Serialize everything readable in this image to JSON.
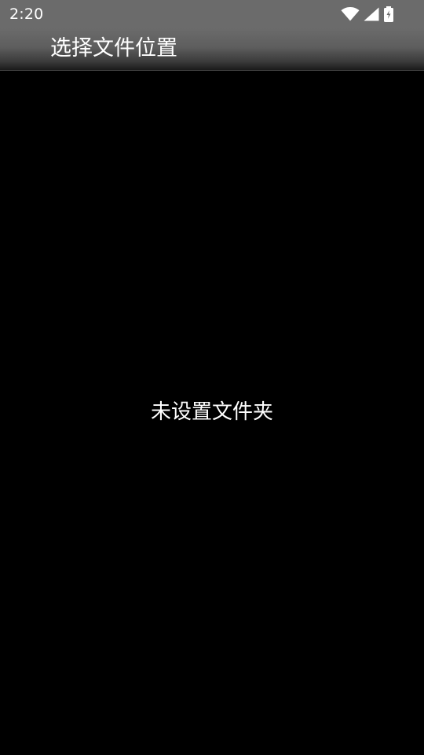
{
  "status_bar": {
    "time": "2:20",
    "icons": [
      "wifi-icon",
      "cellular-signal-icon",
      "battery-charging-icon"
    ]
  },
  "app_bar": {
    "title": "选择文件位置"
  },
  "content": {
    "empty_message": "未设置文件夹"
  },
  "colors": {
    "background": "#000000",
    "bar": "#6b6b6b",
    "text": "#ffffff"
  }
}
